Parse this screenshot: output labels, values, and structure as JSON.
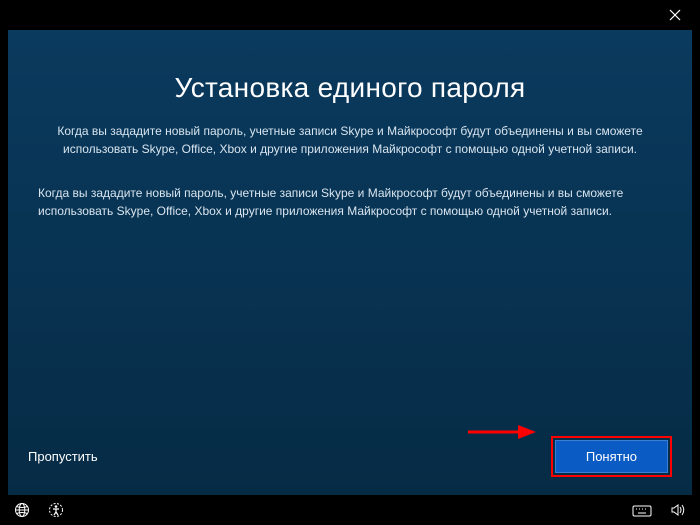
{
  "titlebar": {
    "close_icon": "close"
  },
  "dialog": {
    "title": "Установка единого пароля",
    "subtitle": "Когда вы зададите новый пароль, учетные записи Skype и Майкрософт будут объединены и вы сможете использовать Skype, Office, Xbox и другие приложения Майкрософт с помощью одной учетной записи.",
    "body": "Когда вы зададите новый пароль, учетные записи Skype и Майкрософт будут объединены и вы сможете использовать Skype, Office, Xbox и другие приложения Майкрософт с помощью одной учетной записи."
  },
  "actions": {
    "skip_label": "Пропустить",
    "primary_label": "Понятно"
  },
  "taskbar": {
    "world_icon": "globe",
    "accessibility_icon": "accessibility",
    "keyboard_icon": "keyboard",
    "volume_icon": "volume"
  },
  "annotation": {
    "arrow_color": "#ff0000",
    "highlight_color": "#ff0000"
  }
}
